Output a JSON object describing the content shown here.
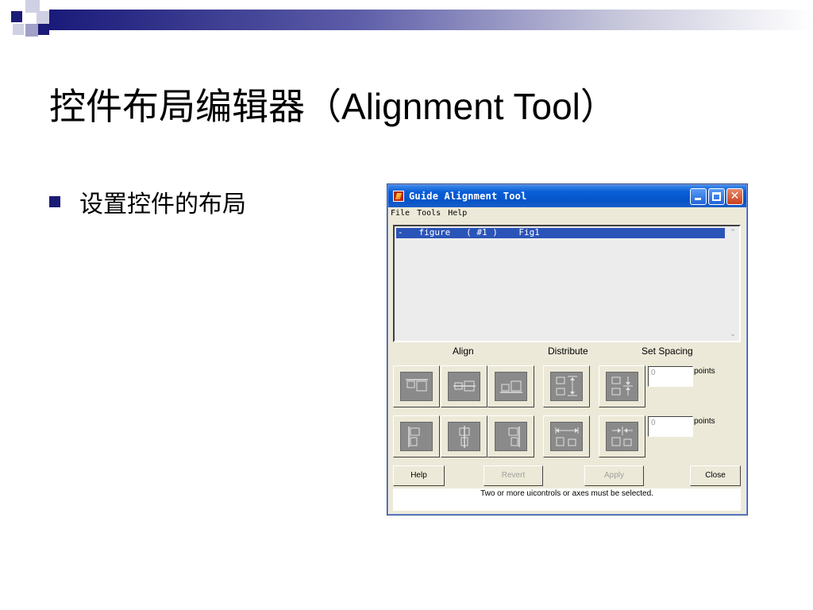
{
  "slide": {
    "title": "控件布局编辑器（Alignment Tool）",
    "bullet": "设置控件的布局"
  },
  "window": {
    "title": "Guide Alignment Tool",
    "minimize_icon": "minimize-icon",
    "maximize_icon": "maximize-icon",
    "close_glyph": "✕",
    "menu": [
      "File",
      "Tools",
      "Help"
    ],
    "list": {
      "selected_row": "-   figure   ( #1 )    Fig1"
    },
    "scroll_up": "⌃",
    "scroll_down": "⌄",
    "sections": {
      "align": "Align",
      "distribute": "Distribute",
      "set_spacing": "Set Spacing"
    },
    "tool_icons": {
      "align_top": "align-top-icon",
      "align_vcenter": "align-vertical-center-icon",
      "align_bottom": "align-bottom-icon",
      "align_left": "align-left-icon",
      "align_hcenter": "align-horizontal-center-icon",
      "align_right": "align-right-icon",
      "distribute_vertical": "distribute-vertical-icon",
      "distribute_horizontal": "distribute-horizontal-icon",
      "spacing_vertical": "set-vertical-spacing-icon",
      "spacing_horizontal": "set-horizontal-spacing-icon"
    },
    "spacing": {
      "vertical_value": "0",
      "horizontal_value": "0",
      "unit": "points"
    },
    "buttons": {
      "help": "Help",
      "revert": "Revert",
      "apply": "Apply",
      "close": "Close"
    },
    "status": "Two or more uicontrols or axes must be selected."
  },
  "colors": {
    "accent": "#1b1b78",
    "titlebar": "#0554c8",
    "selection": "#2b54b8",
    "dialog_bg": "#ece9d8",
    "tool_face": "#8a8a8a"
  }
}
